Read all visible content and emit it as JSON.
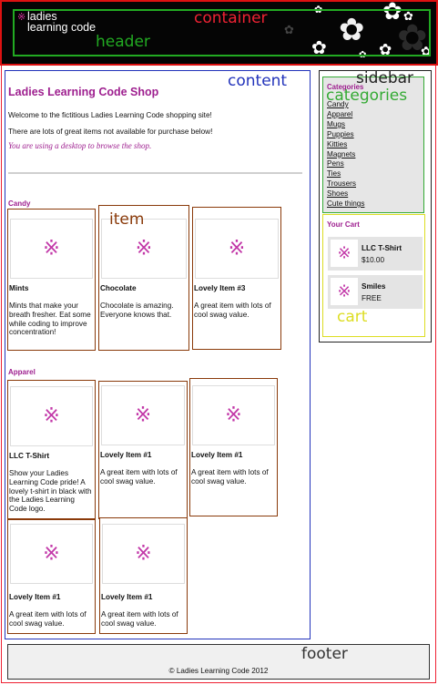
{
  "labels": {
    "container": "container",
    "header": "header",
    "content": "content",
    "sidebar": "sidebar",
    "categories": "categories",
    "item": "item",
    "cart": "cart",
    "footer": "footer"
  },
  "colors": {
    "container": "#ee2233",
    "header": "#22aa22",
    "content": "#2233bb",
    "sidebar": "#222222",
    "categories": "#33aa33",
    "item": "#8a3a0a",
    "cart": "#dddd22",
    "footer": "#333333",
    "brand": "#9e1f8f"
  },
  "logo": {
    "mark": "※",
    "text": "ladies learning code"
  },
  "main": {
    "title": "Ladies Learning Code Shop",
    "welcome": "Welcome to the fictitious Ladies Learning Code shopping site!",
    "items_note": "There are lots of great items not available for purchase below!",
    "device_note": "You are using a desktop to browse the shop."
  },
  "sections": [
    {
      "heading": "Candy",
      "items": [
        {
          "name": "Mints",
          "desc": "Mints that make your breath fresher. Eat some while coding to improve concentration!"
        },
        {
          "name": "Chocolate",
          "desc": "Chocolate is amazing. Everyone knows that."
        },
        {
          "name": "Lovely Item #3",
          "desc": "A great item with lots of cool swag value."
        }
      ]
    },
    {
      "heading": "Apparel",
      "items": [
        {
          "name": "LLC T-Shirt",
          "desc": "Show your Ladies Learning Code pride! A lovely t-shirt in black with the Ladies Learning Code logo."
        },
        {
          "name": "Lovely Item #1",
          "desc": "A great item with lots of cool swag value."
        },
        {
          "name": "Lovely Item #1",
          "desc": "A great item with lots of cool swag value."
        },
        {
          "name": "Lovely Item #1",
          "desc": "A great item with lots of cool swag value."
        },
        {
          "name": "Lovely Item #1",
          "desc": "A great item with lots of cool swag value."
        }
      ]
    }
  ],
  "sidebar": {
    "categories_title": "Categories",
    "categories": [
      "Candy",
      "Apparel",
      "Mugs",
      "Puppies",
      "Kitties",
      "Magnets",
      "Pens",
      "Ties",
      "Trousers",
      "Shoes",
      "Cute things"
    ],
    "cart_title": "Your Cart",
    "cart": [
      {
        "name": "LLC T-Shirt",
        "price": "$10.00"
      },
      {
        "name": "Smiles",
        "price": "FREE"
      }
    ]
  },
  "footer": {
    "text": "© Ladies Learning Code 2012"
  },
  "icons": {
    "placeholder": "asterism-icon"
  }
}
